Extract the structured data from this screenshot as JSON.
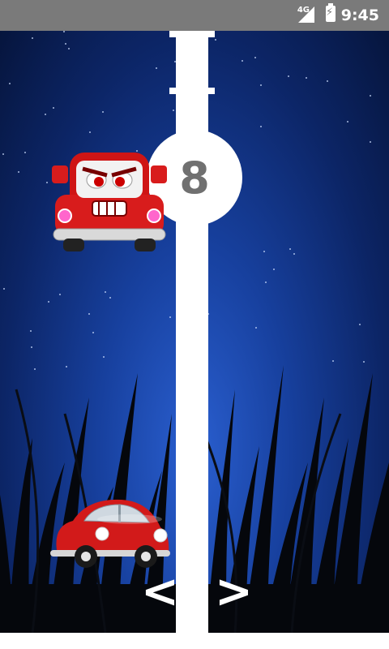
{
  "status_bar": {
    "network": "4G",
    "time": "9:45"
  },
  "game": {
    "score": "8",
    "controls": {
      "left_label": "<",
      "right_label": ">"
    }
  },
  "icons": {
    "enemy": "angry-red-truck-icon",
    "player": "red-beetle-car-icon",
    "signal": "signal-icon",
    "battery": "battery-charging-icon"
  },
  "colors": {
    "status_bar": "#7a7a7a",
    "sky": "#17409e",
    "road_line": "#ffffff",
    "score_text": "#707070",
    "car_red": "#d21a1a"
  }
}
